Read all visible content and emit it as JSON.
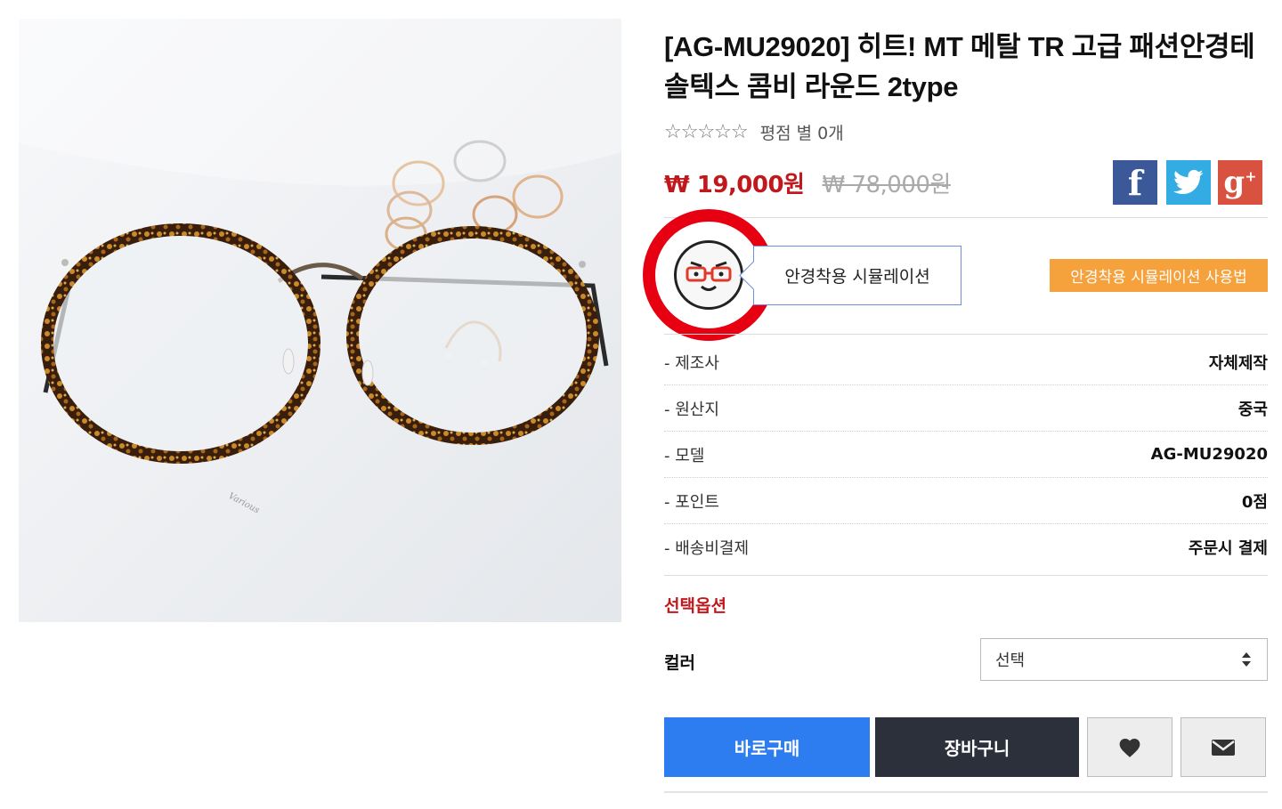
{
  "product": {
    "title": "[AG-MU29020] 히트! MT 메탈 TR 고급 패션안경테 솔텍스 콤비 라운드 2type",
    "stars": "☆☆☆☆☆",
    "rating_text": "평점 별 0개",
    "rating_value": 0,
    "rating_max": 5,
    "price": "₩ 19,000원",
    "old_price": "₩ 78,000원",
    "image_caption": "Various"
  },
  "share": {
    "facebook_icon": "facebook-icon",
    "twitter_icon": "twitter-icon",
    "googleplus_icon": "google-plus-icon",
    "colors": {
      "facebook": "#3b5998",
      "twitter": "#33ace4",
      "googleplus": "#d9513f"
    }
  },
  "simulation": {
    "label": "안경착용 시뮬레이션",
    "howto_label": "안경착용 시뮬레이션 사용법",
    "icon": "face-with-glasses-icon",
    "highlight_color": "#e60012"
  },
  "specs": [
    {
      "label": "- 제조사",
      "value": "자체제작"
    },
    {
      "label": "- 원산지",
      "value": "중국"
    },
    {
      "label": "- 모델",
      "value": "AG-MU29020"
    },
    {
      "label": "- 포인트",
      "value": "0점"
    },
    {
      "label": "- 배송비결제",
      "value": "주문시 결제"
    }
  ],
  "options": {
    "title": "선택옵션",
    "color_label": "컬러",
    "color_selected": "선택"
  },
  "actions": {
    "buy_label": "바로구매",
    "cart_label": "장바구니",
    "wish_icon": "heart-icon",
    "mail_icon": "envelope-icon",
    "buy_color": "#2d7cf0",
    "cart_color": "#2b303a"
  },
  "colors": {
    "price": "#c0181c",
    "accent_orange": "#f5a13c"
  }
}
